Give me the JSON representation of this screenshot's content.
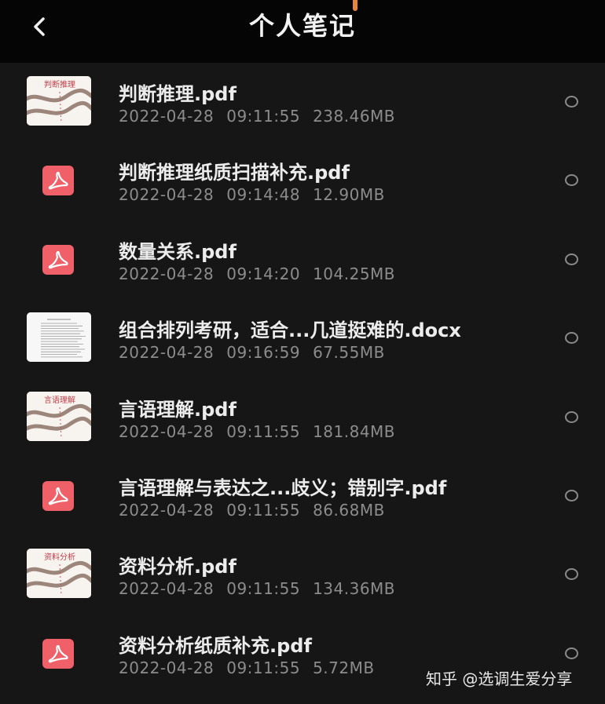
{
  "header": {
    "title": "个人笔记"
  },
  "files": [
    {
      "name": "判断推理.pdf",
      "date": "2022-04-28",
      "time": "09:11:55",
      "size": "238.46MB",
      "thumb": "scan",
      "thumb_text": "判断推理"
    },
    {
      "name": "判断推理纸质扫描补充.pdf",
      "date": "2022-04-28",
      "time": "09:14:48",
      "size": "12.90MB",
      "thumb": "pdf-icon"
    },
    {
      "name": "数量关系.pdf",
      "date": "2022-04-28",
      "time": "09:14:20",
      "size": "104.25MB",
      "thumb": "pdf-icon"
    },
    {
      "name": "组合排列考研，适合...几道挺难的.docx",
      "date": "2022-04-28",
      "time": "09:16:59",
      "size": "67.55MB",
      "thumb": "doc"
    },
    {
      "name": "言语理解.pdf",
      "date": "2022-04-28",
      "time": "09:11:55",
      "size": "181.84MB",
      "thumb": "scan",
      "thumb_text": "言语理解"
    },
    {
      "name": "言语理解与表达之...歧义；错别字.pdf",
      "date": "2022-04-28",
      "time": "09:11:55",
      "size": "86.68MB",
      "thumb": "pdf-icon"
    },
    {
      "name": "资料分析.pdf",
      "date": "2022-04-28",
      "time": "09:11:55",
      "size": "134.36MB",
      "thumb": "scan",
      "thumb_text": "资料分析"
    },
    {
      "name": "资料分析纸质补充.pdf",
      "date": "2022-04-28",
      "time": "09:11:55",
      "size": "5.72MB",
      "thumb": "pdf-icon"
    }
  ],
  "watermark": "知乎 @选调生爱分享",
  "colors": {
    "background": "#161616",
    "header": "#050505",
    "pdf_red": "#f06068",
    "meta_gray": "#8c8c8c"
  }
}
